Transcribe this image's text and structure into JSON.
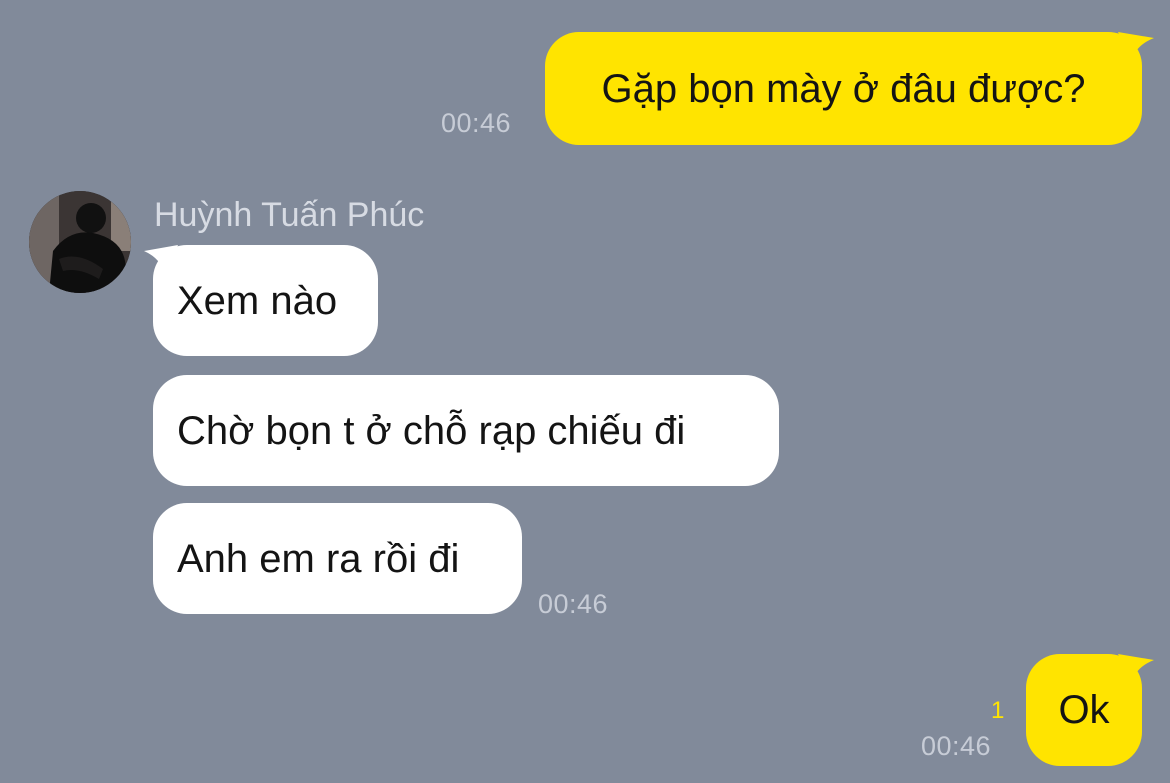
{
  "contact": {
    "name": "Huỳnh Tuấn Phúc",
    "avatar_icon": "contact-avatar-photo"
  },
  "messages": [
    {
      "direction": "outgoing",
      "text": "Gặp bọn mày ở đâu được?",
      "time": "00:46"
    },
    {
      "direction": "incoming",
      "text": "Xem nào"
    },
    {
      "direction": "incoming",
      "text": "Chờ bọn t ở chỗ rạp chiếu đi"
    },
    {
      "direction": "incoming",
      "text": "Anh em ra rồi đi",
      "time": "00:46"
    },
    {
      "direction": "outgoing",
      "text": "Ok",
      "time": "00:46",
      "unread_count": "1"
    }
  ],
  "colors": {
    "background": "#818a9a",
    "outgoing_bubble": "#ffe400",
    "incoming_bubble": "#ffffff",
    "timestamp": "#c7ccd6",
    "unread_count": "#ffe400"
  }
}
